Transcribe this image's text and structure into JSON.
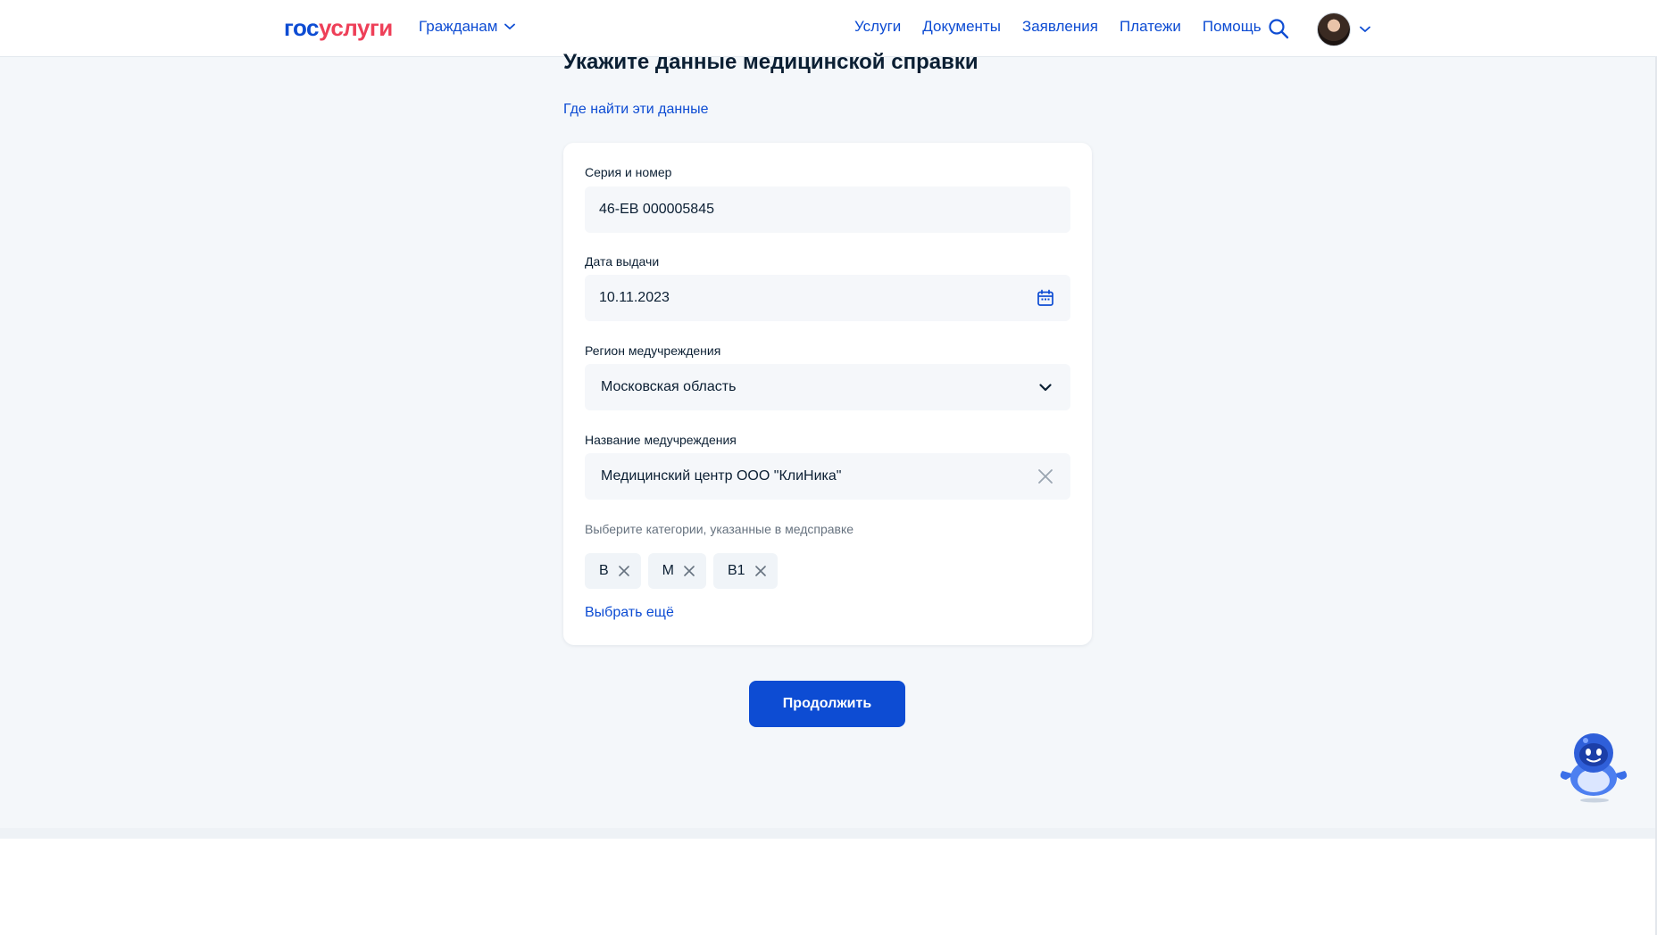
{
  "header": {
    "logo_gos": "гос",
    "logo_uslugi": "услуги",
    "audience_menu": "Гражданам",
    "nav": [
      "Услуги",
      "Документы",
      "Заявления",
      "Платежи",
      "Помощь"
    ]
  },
  "main": {
    "title": "Укажите данные медицинской справки",
    "help_link": "Где найти эти данные"
  },
  "form": {
    "series_label": "Серия и номер",
    "series_value": "46-ЕВ 000005845",
    "date_label": "Дата выдачи",
    "date_value": "10.11.2023",
    "region_label": "Регион медучреждения",
    "region_value": "Московская область",
    "org_label": "Название медучреждения",
    "org_value": "Медицинский центр ООО \"КлиНика\"",
    "categories_label": "Выберите категории, указанные в медсправке",
    "categories": [
      "B",
      "M",
      "B1"
    ],
    "more_link": "Выбрать ещё"
  },
  "actions": {
    "continue": "Продолжить"
  },
  "colors": {
    "brand_blue": "#0d4cd3",
    "brand_red": "#ee3f58",
    "page_bg": "#f4f7fa"
  },
  "icons": {
    "search": "search-icon",
    "calendar": "calendar-icon",
    "chevron": "chevron-down-icon",
    "clear": "close-icon",
    "assistant": "robot-assistant-icon"
  }
}
